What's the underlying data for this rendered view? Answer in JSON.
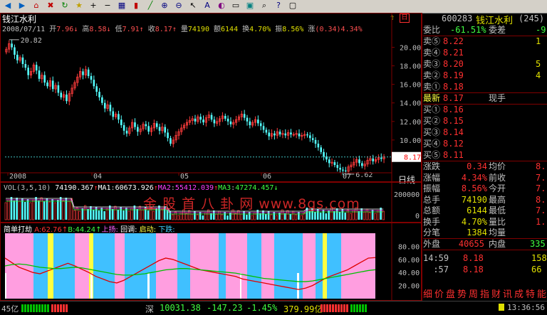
{
  "toolbar": {
    "icons": [
      "back-icon",
      "forward-icon",
      "home-icon",
      "stop-icon",
      "refresh-icon",
      "favorite-icon",
      "plus-icon",
      "minus-icon",
      "grid-icon",
      "candle-icon",
      "line-icon",
      "zoom-in-icon",
      "zoom-out-icon",
      "select-icon",
      "text-icon",
      "color-icon",
      "page-icon",
      "image-icon",
      "search-icon",
      "help-icon",
      "window-icon"
    ]
  },
  "chart": {
    "stock_name": "钱江水利",
    "date": "2008/07/11",
    "ohlc": {
      "open_label": "开",
      "open": "7.96",
      "high_label": "高",
      "high": "8.58",
      "low_label": "低",
      "low": "7.91",
      "close_label": "收",
      "close": "8.17",
      "vol_label": "量",
      "vol": "74190",
      "amt_label": "额",
      "amt": "6144",
      "turn_label": "换",
      "turn": "4.70%",
      "amp_label": "振",
      "amp": "8.56%",
      "chg_label": "涨",
      "chg": "(0.34)",
      "chg_pct": "4.34%"
    },
    "high_marker": "20.82",
    "low_marker": "6.62",
    "current_price_tag": "8.17",
    "period_label": "日线",
    "y_ticks": [
      "20.00",
      "18.00",
      "16.00",
      "14.00",
      "12.00",
      "10.00",
      "8.00"
    ],
    "x_ticks": [
      "2008",
      "04",
      "05",
      "06",
      "07"
    ],
    "top_right_icons": [
      "arrow-icon",
      "day-icon"
    ]
  },
  "chart_data": [
    {
      "type": "candlestick",
      "title": "钱江水利",
      "ylim": [
        6,
        21.5
      ],
      "y_ticks": [
        20,
        18,
        16,
        14,
        12,
        10,
        8
      ],
      "x_ticks": [
        "2008",
        "04",
        "05",
        "06",
        "07"
      ],
      "closes": [
        19.8,
        20.4,
        20.0,
        19.2,
        18.6,
        18.9,
        18.2,
        17.8,
        17.0,
        17.4,
        18.1,
        17.5,
        16.6,
        17.0,
        16.2,
        15.8,
        16.4,
        15.5,
        15.9,
        15.1,
        14.6,
        14.9,
        14.2,
        15.0,
        15.6,
        16.2,
        16.8,
        17.4,
        17.0,
        17.6,
        16.9,
        16.5,
        15.8,
        15.2,
        14.6,
        14.0,
        13.4,
        13.8,
        13.1,
        12.5,
        12.8,
        12.2,
        11.6,
        11.0,
        10.7,
        11.3,
        11.9,
        11.4,
        10.9,
        11.2,
        11.7,
        11.5,
        10.9,
        11.3,
        11.8,
        11.4,
        11.0,
        11.4,
        10.8,
        10.2,
        9.6,
        10.0,
        10.5,
        10.9,
        11.3,
        11.6,
        11.9,
        12.1,
        12.3,
        12.0,
        12.5,
        12.2,
        11.9,
        12.4,
        12.7,
        12.2,
        11.8,
        12.0,
        12.3,
        12.6,
        12.3,
        12.0,
        11.7,
        11.9,
        12.2,
        12.5,
        12.8,
        12.4,
        12.0,
        11.6,
        11.9,
        12.2,
        11.8,
        11.5,
        11.1,
        10.8,
        10.4,
        10.7,
        10.5,
        10.9,
        10.6,
        10.7,
        10.5,
        10.8,
        10.6,
        10.6,
        10.7,
        10.4,
        10.5,
        10.6,
        10.5,
        10.2,
        10.0,
        9.6,
        9.2,
        8.7,
        8.2,
        7.9,
        7.5,
        7.6,
        7.3,
        7.0,
        6.8,
        6.7,
        6.62,
        7.1,
        7.3,
        7.6,
        7.9,
        7.5,
        7.2,
        7.4,
        7.8,
        8.0,
        7.7,
        7.9,
        8.1,
        7.96,
        8.17
      ]
    },
    {
      "type": "bar",
      "title": "VOL(3,5,10)",
      "ylim": [
        0,
        280000
      ],
      "y_ticks": [
        200000,
        0
      ],
      "series": [
        {
          "name": "VOL",
          "values": [
            74190.367
          ]
        },
        {
          "name": "MA1",
          "values": [
            60673.926
          ]
        },
        {
          "name": "MA2",
          "values": [
            55412.039
          ]
        },
        {
          "name": "MA3",
          "values": [
            47274.457
          ]
        }
      ]
    },
    {
      "type": "line",
      "title": "简单打劫",
      "ylim": [
        0,
        100
      ],
      "y_ticks": [
        80,
        60,
        40,
        20
      ],
      "series": [
        {
          "name": "A",
          "values": [
            62.76
          ]
        },
        {
          "name": "B",
          "values": [
            44.24
          ]
        }
      ]
    }
  ],
  "vol": {
    "title": "VOL(3,5,10)",
    "vol_value": "74190.367",
    "ma1_label": "MA1",
    "ma1": "60673.926",
    "ma2_label": "MA2",
    "ma2": "55412.039",
    "ma3_label": "MA3",
    "ma3": "47274.457",
    "y_ticks": [
      "200000",
      "0"
    ],
    "watermark": "金 股 首 八 卦 网 www.8gs.com"
  },
  "indicator": {
    "title": "简单打劫",
    "a_label": "A:",
    "a_value": "62.76",
    "b_label": "B:",
    "b_value": "44.24",
    "up_label": "上扬:",
    "back_label": "回调:",
    "start_label": "启动:",
    "down_label": "下跌:",
    "y_ticks": [
      "80.00",
      "60.00",
      "40.00",
      "20.00"
    ]
  },
  "quote": {
    "code": "600283",
    "name": "钱江水利",
    "number": "(245)",
    "wei_bi_label": "委比",
    "wei_bi": "-61.51%",
    "wei_cha_label": "委差",
    "wei_cha": "-9",
    "sells": [
      {
        "label": "卖⑤",
        "price": "8.22",
        "vol": "1"
      },
      {
        "label": "卖④",
        "price": "8.21",
        "vol": ""
      },
      {
        "label": "卖③",
        "price": "8.20",
        "vol": "5"
      },
      {
        "label": "卖②",
        "price": "8.19",
        "vol": "4"
      },
      {
        "label": "卖①",
        "price": "8.18",
        "vol": ""
      }
    ],
    "latest_label": "最新",
    "latest": "8.17",
    "current_hand_label": "现手",
    "buys": [
      {
        "label": "买①",
        "price": "8.16",
        "vol": ""
      },
      {
        "label": "买②",
        "price": "8.15",
        "vol": ""
      },
      {
        "label": "买③",
        "price": "8.14",
        "vol": ""
      },
      {
        "label": "买④",
        "price": "8.12",
        "vol": ""
      },
      {
        "label": "买⑤",
        "price": "8.11",
        "vol": ""
      }
    ],
    "stats": [
      {
        "l1": "涨跌",
        "v1": "0.34",
        "l2": "均价",
        "v2": "8."
      },
      {
        "l1": "涨幅",
        "v1": "4.34%",
        "l2": "前收",
        "v2": "7."
      },
      {
        "l1": "振幅",
        "v1": "8.56%",
        "l2": "今开",
        "v2": "7."
      },
      {
        "l1": "总手",
        "v1": "74190",
        "l2": "最高",
        "v2": "8."
      },
      {
        "l1": "总额",
        "v1": "6144",
        "l2": "最低",
        "v2": "7."
      },
      {
        "l1": "换手",
        "v1": "4.70%",
        "l2": "量比",
        "v2": "1."
      },
      {
        "l1": "分笔",
        "v1": "1384",
        "l2": "均量",
        "v2": ""
      }
    ],
    "outer_label": "外盘",
    "outer": "40655",
    "inner_label": "内盘",
    "inner": "335",
    "ticks": [
      {
        "time": "14:59",
        "price": "8.18",
        "vol": "158"
      },
      {
        "time": ":57",
        "price": "8.18",
        "vol": "66"
      }
    ],
    "bottom_tabs": [
      "细",
      "价",
      "盘",
      "势",
      "周",
      "指",
      "财",
      "讯",
      "成",
      "特",
      "能"
    ]
  },
  "status": {
    "left_value": "45亿",
    "market_label": "深",
    "index": "10031.38",
    "change": "-147.23",
    "pct": "-1.45%",
    "amount": "379.99亿",
    "time": "13:36:56"
  }
}
